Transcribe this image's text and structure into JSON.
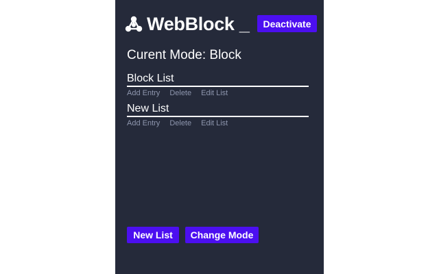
{
  "app": {
    "title": "WebBlock _",
    "logo_icon": "network-nodes-icon",
    "deactivate_label": "Deactivate"
  },
  "mode": {
    "text": "Curent Mode: Block"
  },
  "lists": [
    {
      "name": "Block List",
      "actions": [
        "Add Entry",
        "Delete",
        "Edit List"
      ]
    },
    {
      "name": "New List",
      "actions": [
        "Add Entry",
        "Delete",
        "Edit List"
      ]
    }
  ],
  "footer": {
    "new_list_label": "New List",
    "change_mode_label": "Change Mode"
  },
  "colors": {
    "panel_background": "#252a3a",
    "accent": "#4c0ff0",
    "action_text": "#8e96ae",
    "text": "#ffffff"
  }
}
